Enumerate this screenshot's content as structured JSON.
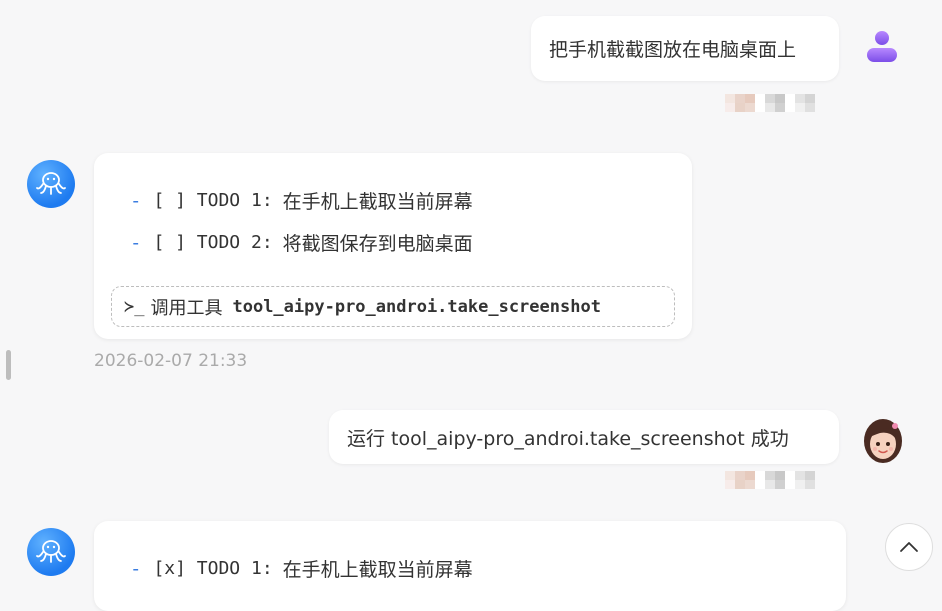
{
  "messages": {
    "user1": {
      "text": "把手机截截图放在电脑桌面上"
    },
    "bot1": {
      "todos": [
        {
          "dash": "-",
          "box": "[ ] TODO 1:",
          "text": "在手机上截取当前屏幕"
        },
        {
          "dash": "-",
          "box": "[ ] TODO 2:",
          "text": "将截图保存到电脑桌面"
        }
      ],
      "tool": {
        "prompt": "≻_",
        "label": "调用工具",
        "name": "tool_aipy-pro_androi.take_screenshot"
      },
      "timestamp": "2026-02-07 21:33"
    },
    "user2": {
      "text": "运行 tool_aipy-pro_androi.take_screenshot 成功"
    },
    "bot2": {
      "todos": [
        {
          "dash": "-",
          "box": "[x] TODO 1:",
          "text": "在手机上截取当前屏幕"
        }
      ]
    }
  },
  "icons": {
    "user_avatar": "person-icon",
    "bot_avatar": "octopus-icon",
    "user2_avatar": "girl-avatar",
    "scroll_top": "chevron-up-icon"
  },
  "colors": {
    "accent": "#3b7de0",
    "bot_avatar": "#1e7bf0",
    "user_avatar": "#8b5cf6"
  }
}
